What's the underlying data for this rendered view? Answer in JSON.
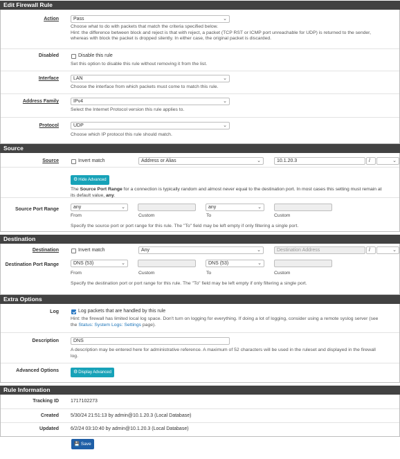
{
  "edit": {
    "title": "Edit Firewall Rule",
    "action": {
      "label": "Action",
      "value": "Pass",
      "help1": "Choose what to do with packets that match the criteria specified below.",
      "help2": "Hint: the difference between block and reject is that with reject, a packet (TCP RST or ICMP port unreachable for UDP) is returned to the sender,",
      "help3": "whereas with block the packet is dropped silently. In either case, the original packet is discarded."
    },
    "disabled": {
      "label": "Disabled",
      "checkbox": "Disable this rule",
      "help": "Set this option to disable this rule without removing it from the list."
    },
    "interface": {
      "label": "Interface",
      "value": "LAN",
      "help": "Choose the interface from which packets must come to match this rule."
    },
    "family": {
      "label": "Address Family",
      "value": "IPv4",
      "help": "Select the Internet Protocol version this rule applies to."
    },
    "protocol": {
      "label": "Protocol",
      "value": "UDP",
      "help": "Choose which IP protocol this rule should match."
    }
  },
  "source": {
    "title": "Source",
    "label": "Source",
    "invert": "Invert match",
    "type": "Address or Alias",
    "address": "10.1.20.3",
    "slash": "/",
    "hide_adv": "Hide Advanced",
    "adv_help_pre": "The ",
    "adv_help_bold": "Source Port Range",
    "adv_help_mid": " for a connection is typically random and almost never equal to the destination port. In most cases this setting must remain at",
    "adv_help_line2_pre": "its default value, ",
    "adv_help_line2_bold": "any",
    "adv_help_line2_end": ".",
    "port_label": "Source Port Range",
    "from": "any",
    "to": "any",
    "from_sub": "From",
    "custom1": "Custom",
    "to_sub": "To",
    "custom2": "Custom",
    "port_help": "Specify the source port or port range for this rule. The \"To\" field may be left empty if only filtering a single port."
  },
  "destination": {
    "title": "Destination",
    "label": "Destination",
    "invert": "Invert match",
    "type": "Any",
    "address_placeholder": "Destination Address",
    "slash": "/",
    "port_label": "Destination Port Range",
    "from": "DNS (53)",
    "to": "DNS (53)",
    "from_sub": "From",
    "custom1": "Custom",
    "to_sub": "To",
    "custom2": "Custom",
    "port_help": "Specify the destination port or port range for this rule. The \"To\" field may be left empty if only filtering a single port."
  },
  "extra": {
    "title": "Extra Options",
    "log_label": "Log",
    "log_checkbox": "Log packets that are handled by this rule",
    "log_help1": "Hint: the firewall has limited local log space. Don't turn on logging for everything. If doing a lot of logging, consider using a remote syslog server (see",
    "log_help2_pre": "the ",
    "log_help2_link": "Status: System Logs: Settings",
    "log_help2_end": " page).",
    "desc_label": "Description",
    "desc_value": "DNS",
    "desc_help1": "A description may be entered here for administrative reference. A maximum of 52 characters will be used in the ruleset and displayed in the firewall",
    "desc_help2": "log.",
    "adv_label": "Advanced Options",
    "adv_button": "Display Advanced"
  },
  "info": {
    "title": "Rule Information",
    "tracking_label": "Tracking ID",
    "tracking_value": "1717102273",
    "created_label": "Created",
    "created_value": "5/30/24 21:51:13 by admin@10.1.20.3 (Local Database)",
    "updated_label": "Updated",
    "updated_value": "6/2/24 03:10:40 by admin@10.1.20.3 (Local Database)"
  },
  "save_label": "Save"
}
